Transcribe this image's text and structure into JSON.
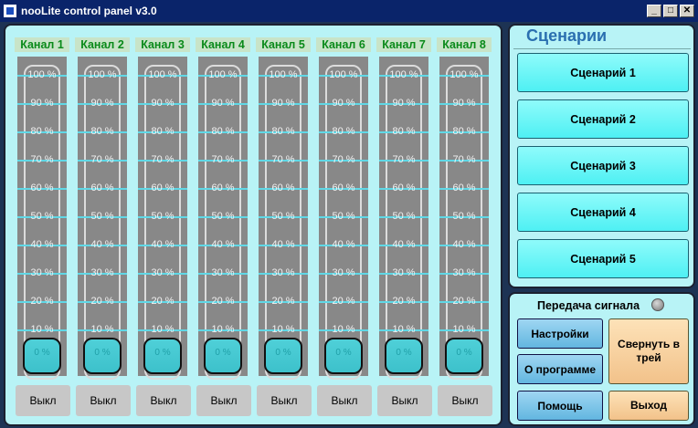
{
  "window": {
    "title": "nooLite control panel v3.0",
    "buttons": {
      "minimize": "_",
      "maximize": "□",
      "close": "✕"
    }
  },
  "channels": [
    {
      "label": "Канал 1",
      "level_percent": 0,
      "level_text": "0 %",
      "off_label": "Выкл"
    },
    {
      "label": "Канал 2",
      "level_percent": 0,
      "level_text": "0 %",
      "off_label": "Выкл"
    },
    {
      "label": "Канал 3",
      "level_percent": 0,
      "level_text": "0 %",
      "off_label": "Выкл"
    },
    {
      "label": "Канал 4",
      "level_percent": 0,
      "level_text": "0 %",
      "off_label": "Выкл"
    },
    {
      "label": "Канал 5",
      "level_percent": 0,
      "level_text": "0 %",
      "off_label": "Выкл"
    },
    {
      "label": "Канал 6",
      "level_percent": 0,
      "level_text": "0 %",
      "off_label": "Выкл"
    },
    {
      "label": "Канал 7",
      "level_percent": 0,
      "level_text": "0 %",
      "off_label": "Выкл"
    },
    {
      "label": "Канал 8",
      "level_percent": 0,
      "level_text": "0 %",
      "off_label": "Выкл"
    }
  ],
  "scale_ticks": [
    "100 %",
    "90 %",
    "80 %",
    "70 %",
    "60 %",
    "50 %",
    "40 %",
    "30 %",
    "20 %",
    "10 %"
  ],
  "scenarios": {
    "title": "Сценарии",
    "items": [
      "Сценарий 1",
      "Сценарий 2",
      "Сценарий 3",
      "Сценарий 4",
      "Сценарий 5"
    ]
  },
  "controls": {
    "signal_label": "Передача сигнала",
    "settings": "Настройки",
    "about": "О программе",
    "help": "Помощь",
    "minimize_to_tray": "Свернуть в трей",
    "exit": "Выход"
  },
  "colors": {
    "panel_bg": "#b8f3f6",
    "channel_label": "#0a8a1a",
    "slider_thumb": "#4fd0d8",
    "scenario_button": "#6ff5f7",
    "scenario_title": "#2a6fb0"
  }
}
